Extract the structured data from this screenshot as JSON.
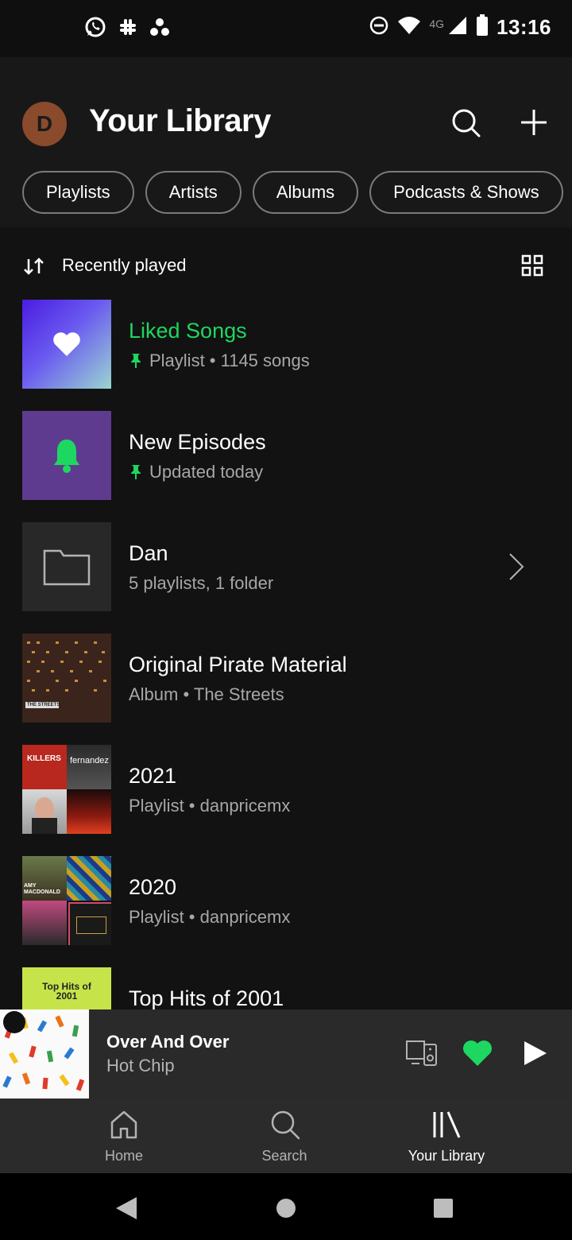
{
  "status_bar": {
    "time": "13:16",
    "network": "4G",
    "left_icons": [
      "whatsapp-icon",
      "slack-icon",
      "app-dots-icon"
    ],
    "right_icons": [
      "do-not-disturb-icon",
      "wifi-icon",
      "signal-icon",
      "battery-icon"
    ]
  },
  "header": {
    "avatar_letter": "D",
    "title": "Your Library",
    "actions": [
      "search-icon",
      "plus-icon"
    ]
  },
  "filters": [
    "Playlists",
    "Artists",
    "Albums",
    "Podcasts & Shows"
  ],
  "sort": {
    "label": "Recently played",
    "view_icon": "grid-view-icon"
  },
  "items": [
    {
      "title": "Liked Songs",
      "subtitle": "Playlist • 1145 songs",
      "pinned": true,
      "title_color": "#1ed760",
      "art": "liked-songs-heart"
    },
    {
      "title": "New Episodes",
      "subtitle": "Updated today",
      "pinned": true,
      "art": "new-episodes-bell"
    },
    {
      "title": "Dan",
      "subtitle": "5 playlists, 1 folder",
      "art": "folder",
      "chevron": true
    },
    {
      "title": "Original Pirate Material",
      "subtitle": "Album • The Streets",
      "art": "album-cover"
    },
    {
      "title": "2021",
      "subtitle": "Playlist • danpricemx",
      "art": "mosaic"
    },
    {
      "title": "2020",
      "subtitle": "Playlist • danpricemx",
      "art": "mosaic"
    },
    {
      "title": "Top Hits of 2001",
      "subtitle": "",
      "art": "top-hits-cover"
    }
  ],
  "art_text": {
    "mosaic_2021": [
      "KILLERS",
      "fernandez"
    ],
    "mosaic_2020": [
      "AMY MACDONALD"
    ],
    "top_hits": "Top Hits of 2001",
    "streets_label": "THE STREETS"
  },
  "now_playing": {
    "title": "Over And Over",
    "artist": "Hot Chip",
    "liked": true,
    "controls": [
      "devices-icon",
      "heart-icon",
      "play-icon"
    ]
  },
  "bottom_nav": [
    {
      "label": "Home",
      "icon": "home-icon",
      "active": false
    },
    {
      "label": "Search",
      "icon": "search-icon",
      "active": false
    },
    {
      "label": "Your Library",
      "icon": "library-icon",
      "active": true
    }
  ],
  "colors": {
    "accent": "#1ed760",
    "background": "#121212",
    "header": "#181818",
    "miniplayer": "#2a2a2a",
    "nav": "#2b2b2b"
  }
}
